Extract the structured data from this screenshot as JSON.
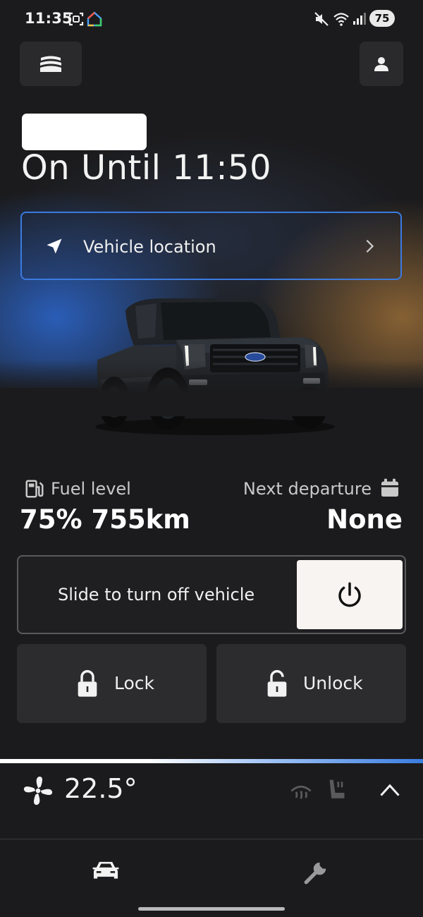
{
  "status_bar": {
    "time": "11:35",
    "battery": "75"
  },
  "header": {
    "menu_icon": "vehicle-menu-icon",
    "profile_icon": "person-icon"
  },
  "vehicle_status": {
    "headline": "On Until 11:50"
  },
  "location_card": {
    "label": "Vehicle location",
    "icon": "navigation-arrow-icon",
    "accent": "#3b7be0"
  },
  "stats": {
    "fuel_label": "Fuel level",
    "fuel_value": "75% 755km",
    "departure_label": "Next departure",
    "departure_value": "None"
  },
  "controls": {
    "slide_label": "Slide to turn off vehicle",
    "lock_label": "Lock",
    "unlock_label": "Unlock"
  },
  "climate": {
    "temperature": "22.5°"
  },
  "bottom_nav": {
    "items": [
      {
        "icon": "car-icon"
      },
      {
        "icon": "wrench-icon"
      }
    ]
  }
}
